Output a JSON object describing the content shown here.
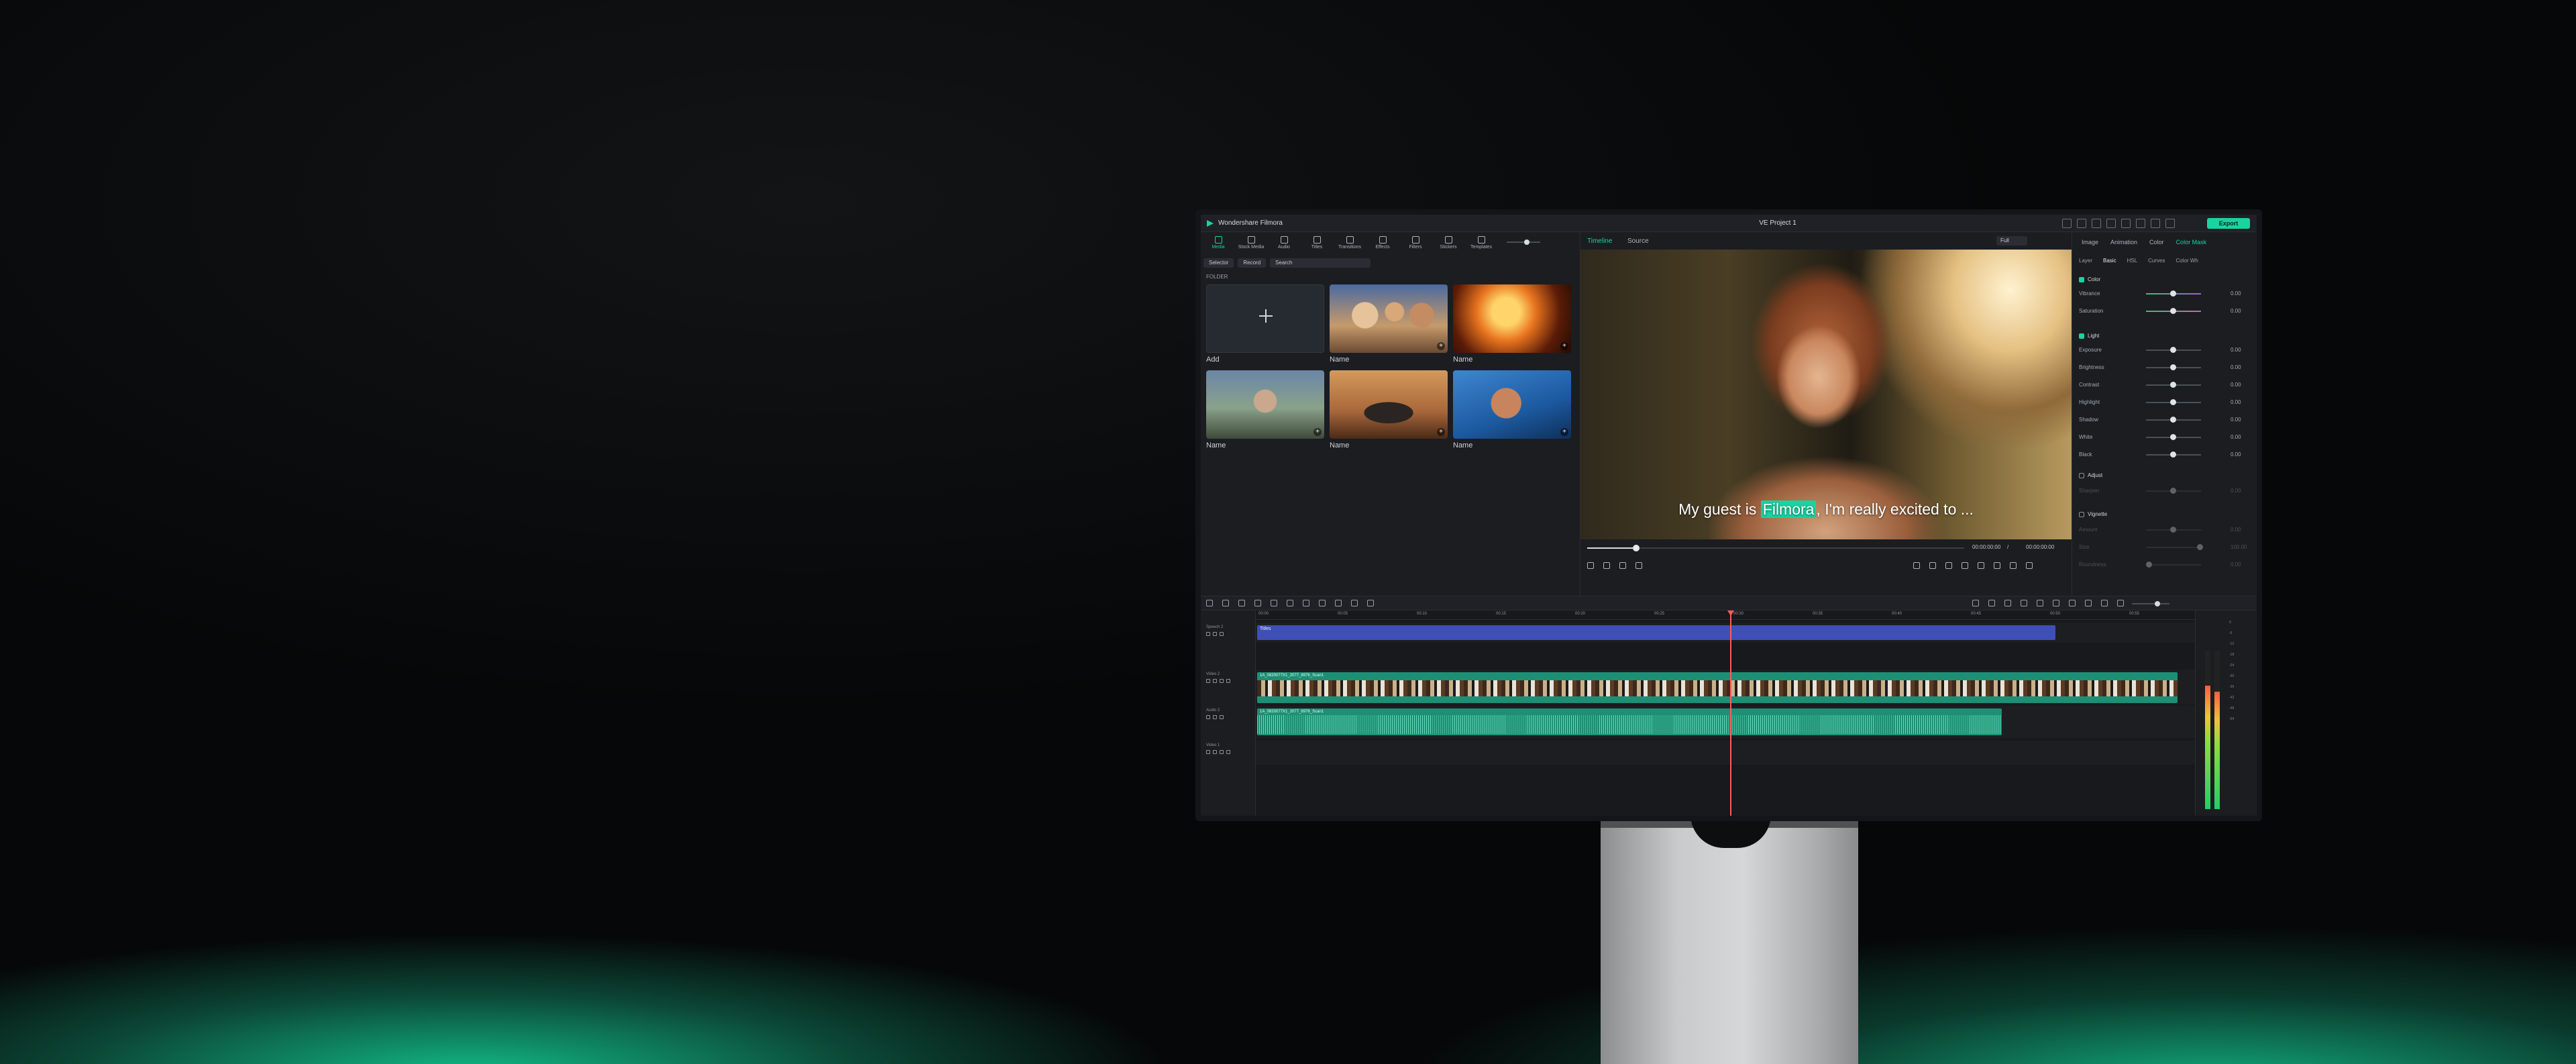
{
  "app": {
    "title": "Wondershare Filmora",
    "project": "VE Project 1",
    "export_label": "Export"
  },
  "media": {
    "tabs": [
      "Media",
      "Stock Media",
      "Audio",
      "Titles",
      "Transitions",
      "Effects",
      "Filters",
      "Stickers",
      "Templates"
    ],
    "selector_label": "Selector",
    "record_label": "Record",
    "search_placeholder": "Search",
    "folder_label": "FOLDER",
    "add_label": "Add",
    "items": [
      "Name",
      "Name",
      "Name",
      "Name",
      "Name"
    ]
  },
  "preview": {
    "tabs": [
      "Timeline",
      "Source"
    ],
    "quality": "Full",
    "caption_before": "My guest is ",
    "caption_highlight": "Filmora",
    "caption_after": ", I'm really excited to ...",
    "time_current": "00:00:00:00",
    "time_sep": "/",
    "time_total": "00:00:00:00",
    "progress": 0.13
  },
  "properties": {
    "tabs": [
      "Image",
      "Animation",
      "Color",
      "Color Mask"
    ],
    "active_tab": "Color Mask",
    "subtabs": [
      "Layer",
      "Basic",
      "HSL",
      "Curves",
      "Color Wh"
    ],
    "active_subtab": "Basic",
    "color": {
      "label": "Color",
      "rows": [
        {
          "label": "Vibrance",
          "value": "0.00"
        },
        {
          "label": "Saturation",
          "value": "0.00"
        }
      ]
    },
    "light": {
      "label": "Light",
      "rows": [
        {
          "label": "Exposure",
          "value": "0.00"
        },
        {
          "label": "Brightness",
          "value": "0.00"
        },
        {
          "label": "Contrast",
          "value": "0.00"
        },
        {
          "label": "Highlight",
          "value": "0.00"
        },
        {
          "label": "Shadow",
          "value": "0.00"
        },
        {
          "label": "White",
          "value": "0.00"
        },
        {
          "label": "Black",
          "value": "0.00"
        }
      ]
    },
    "adjust": {
      "label": "Adjust",
      "rows": [
        {
          "label": "Sharpen",
          "value": "0.00"
        }
      ]
    },
    "vignette": {
      "label": "Vignette",
      "rows": [
        {
          "label": "Amount",
          "value": "0.00"
        },
        {
          "label": "Size",
          "value": "100.00"
        },
        {
          "label": "Roundness",
          "value": "0.00"
        }
      ]
    }
  },
  "timeline": {
    "ruler": [
      "00:00",
      "00:05",
      "00:10",
      "00:15",
      "00:20",
      "00:25",
      "00:30",
      "00:35",
      "00:40",
      "00:45",
      "00:50",
      "00:55",
      "01:00"
    ],
    "tracks": [
      {
        "name": "Speech 2"
      },
      {
        "name": "Video 2"
      },
      {
        "name": "Audio 2"
      },
      {
        "name": "Video 1"
      }
    ],
    "title_clip": "Titles",
    "video_clip": "1A_0820077X1_2077_8976_Scan1",
    "audio_clip": "1A_0820077X1_2077_8976_Scan1"
  },
  "meter": {
    "scale": [
      "0",
      "-6",
      "-12",
      "-18",
      "-24",
      "-30",
      "-36",
      "-42",
      "-48",
      "-54"
    ],
    "left_level": 0.78,
    "right_level": 0.74
  },
  "colors": {
    "accent": "#19d3a0",
    "title_clip": "#3f4fb8",
    "media_clip": "#1e8f74",
    "playhead": "#ff5b5b"
  }
}
